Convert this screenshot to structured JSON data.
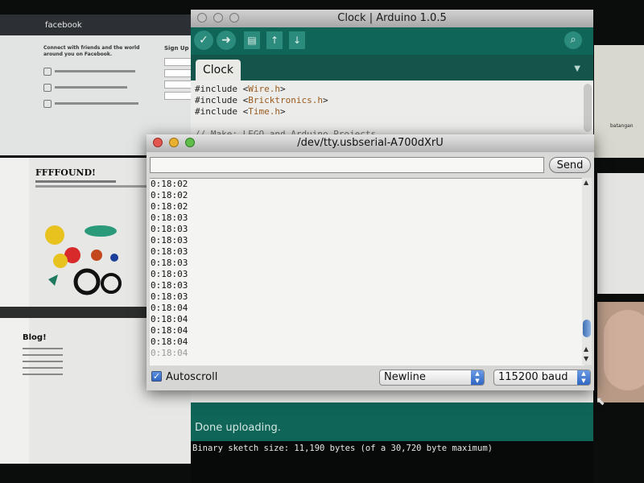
{
  "background": {
    "facebook": {
      "logo": "facebook",
      "tagline": "Connect with friends and the world around you on Facebook.",
      "signup": "Sign Up"
    },
    "ffffound": {
      "title": "FFFFOUND!",
      "blog": "Blog!"
    },
    "right_page_text": "batangan"
  },
  "ide": {
    "title": "Clock | Arduino 1.0.5",
    "tab": "Clock",
    "code_lines": [
      {
        "prefix": "#include <",
        "lib": "Wire.h",
        "suffix": ">"
      },
      {
        "prefix": "#include <",
        "lib": "Bricktronics.h",
        "suffix": ">"
      },
      {
        "prefix": "#include <",
        "lib": "Time.h",
        "suffix": ">"
      }
    ],
    "comment": "// Make: LEGO and Arduino Projects",
    "status": "Done uploading.",
    "console": "Binary sketch size: 11,190 bytes (of a 30,720 byte maximum)",
    "toolbar_icons": [
      "verify-icon",
      "upload-icon",
      "new-icon",
      "open-icon",
      "save-icon",
      "serial-monitor-icon"
    ]
  },
  "serial": {
    "title": "/dev/tty.usbserial-A700dXrU",
    "input_value": "",
    "send_label": "Send",
    "lines": [
      "0:18:02",
      "0:18:02",
      "0:18:02",
      "0:18:03",
      "0:18:03",
      "0:18:03",
      "0:18:03",
      "0:18:03",
      "0:18:03",
      "0:18:03",
      "0:18:03",
      "0:18:04",
      "0:18:04",
      "0:18:04",
      "0:18:04",
      "0:18:04"
    ],
    "autoscroll_label": "Autoscroll",
    "autoscroll_checked": true,
    "line_ending": "Newline",
    "baud_rate": "115200 baud"
  }
}
